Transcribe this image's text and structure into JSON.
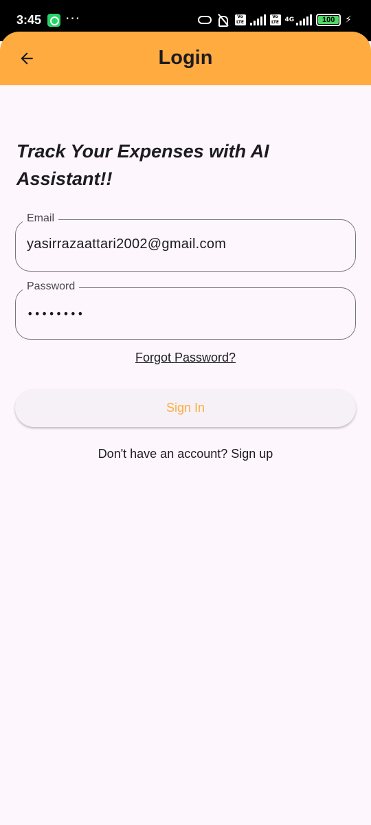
{
  "status_bar": {
    "time": "3:45",
    "network_label": "4G",
    "volte_label": "Vo LTE",
    "battery": "100",
    "icons": [
      "whatsapp-icon",
      "more-dots-icon",
      "link-icon",
      "mute-icon",
      "volte-icon",
      "signal-icon",
      "battery-icon",
      "charging-bolt-icon"
    ]
  },
  "app_bar": {
    "title": "Login",
    "back_icon": "arrow-left-icon",
    "background_color": "#ffab40"
  },
  "headline": "Track Your Expenses with AI Assistant!!",
  "form": {
    "email_label": "Email",
    "email_value": "yasirrazaattari2002@gmail.com",
    "password_label": "Password",
    "password_value": "••••••••",
    "forgot_password": "Forgot Password?",
    "sign_in_label": "Sign In",
    "signup_prompt": "Don't have an account? Sign up"
  },
  "colors": {
    "accent": "#ffab40",
    "background": "#fdf7fd",
    "outline": "#79747e"
  }
}
